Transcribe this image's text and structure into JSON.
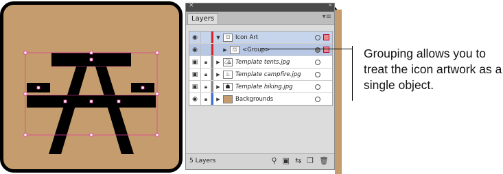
{
  "panel": {
    "tab_label": "Layers",
    "footer_count": "5 Layers",
    "rows": [
      {
        "name": "Icon Art",
        "italic": false
      },
      {
        "name": "<Group>",
        "italic": false
      },
      {
        "name": "Template tents.jpg",
        "italic": true
      },
      {
        "name": "Template campfire.jpg",
        "italic": true
      },
      {
        "name": "Template hiking.jpg",
        "italic": true
      },
      {
        "name": "Backgrounds",
        "italic": false
      }
    ]
  },
  "annotation": {
    "text": "Grouping allows you to treat the icon artwork as a single object."
  },
  "colors": {
    "artwork_bg": "#c59c6d",
    "selection": "#c6d4ec",
    "selection_handle": "#e0409a"
  },
  "icons": {
    "eye": "eye-icon",
    "lock": "lock-icon",
    "expand": "triangle-icon",
    "target": "target-icon"
  }
}
